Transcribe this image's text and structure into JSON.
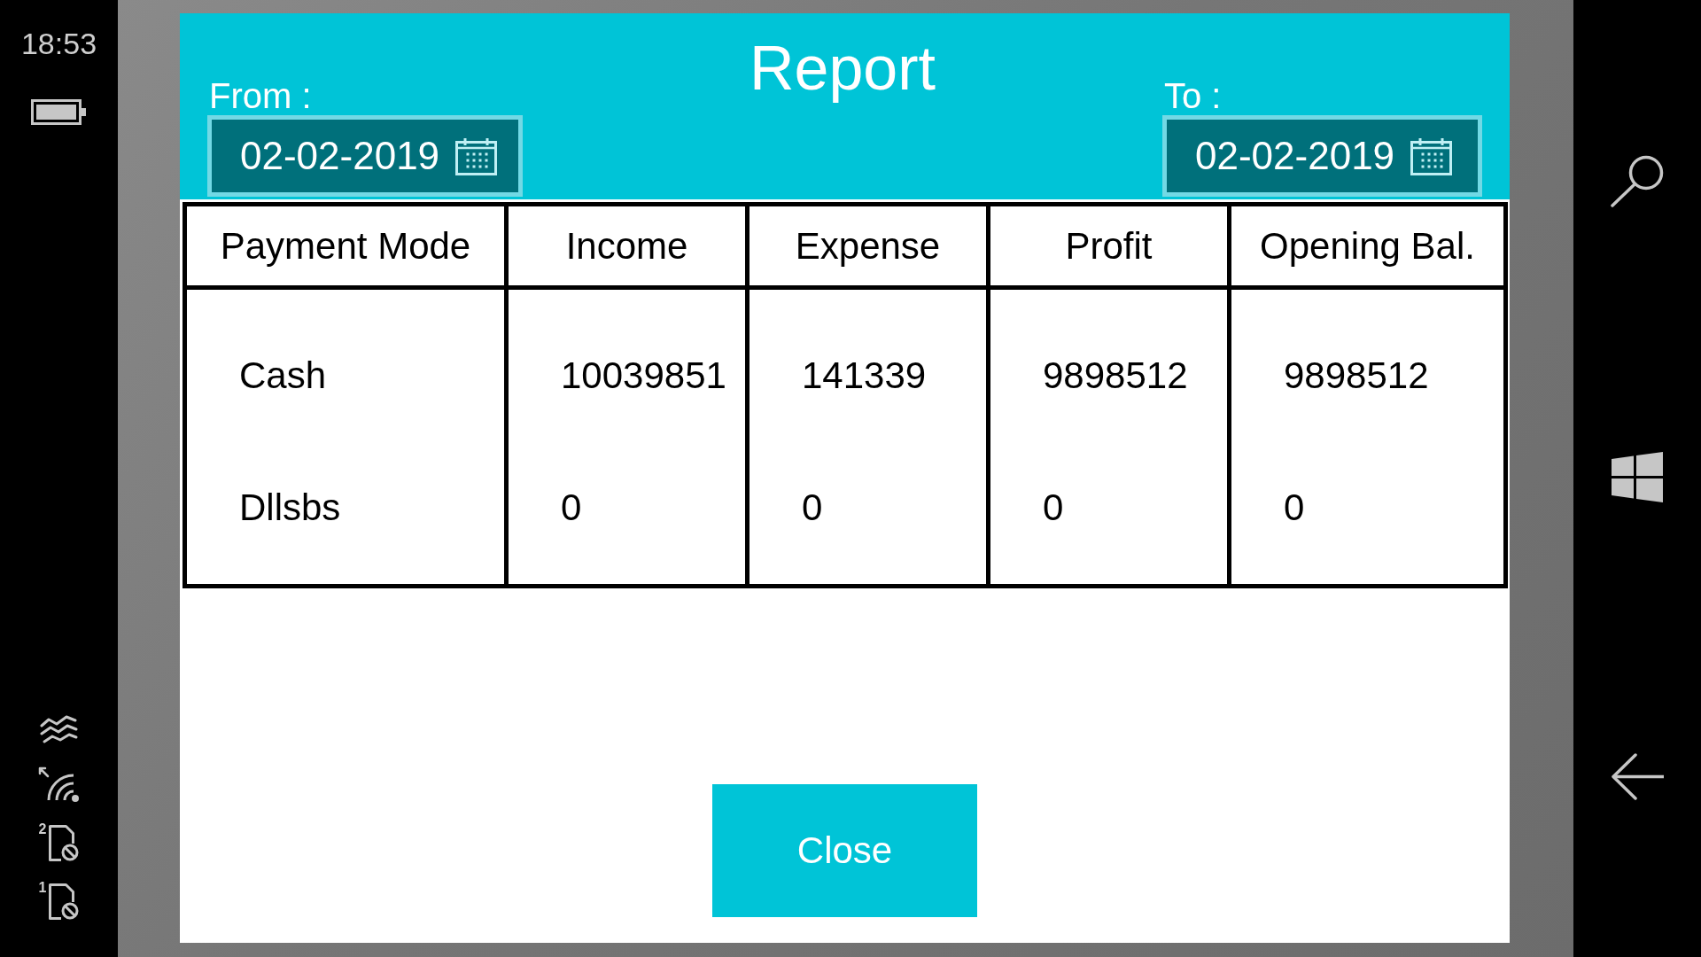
{
  "status_bar": {
    "time": "18:53",
    "sim_slots": [
      "2",
      "1"
    ]
  },
  "dialog": {
    "title": "Report",
    "from": {
      "label": "From :",
      "value": "02-02-2019"
    },
    "to": {
      "label": "To :",
      "value": "02-02-2019"
    },
    "table": {
      "columns": [
        "Payment Mode",
        "Income",
        "Expense",
        "Profit",
        "Opening Bal."
      ],
      "rows": [
        [
          "Cash",
          "10039851",
          "141339",
          "9898512",
          "9898512"
        ],
        [
          "Dllsbs",
          "0",
          "0",
          "0",
          "0"
        ]
      ]
    },
    "close_button": "Close"
  }
}
